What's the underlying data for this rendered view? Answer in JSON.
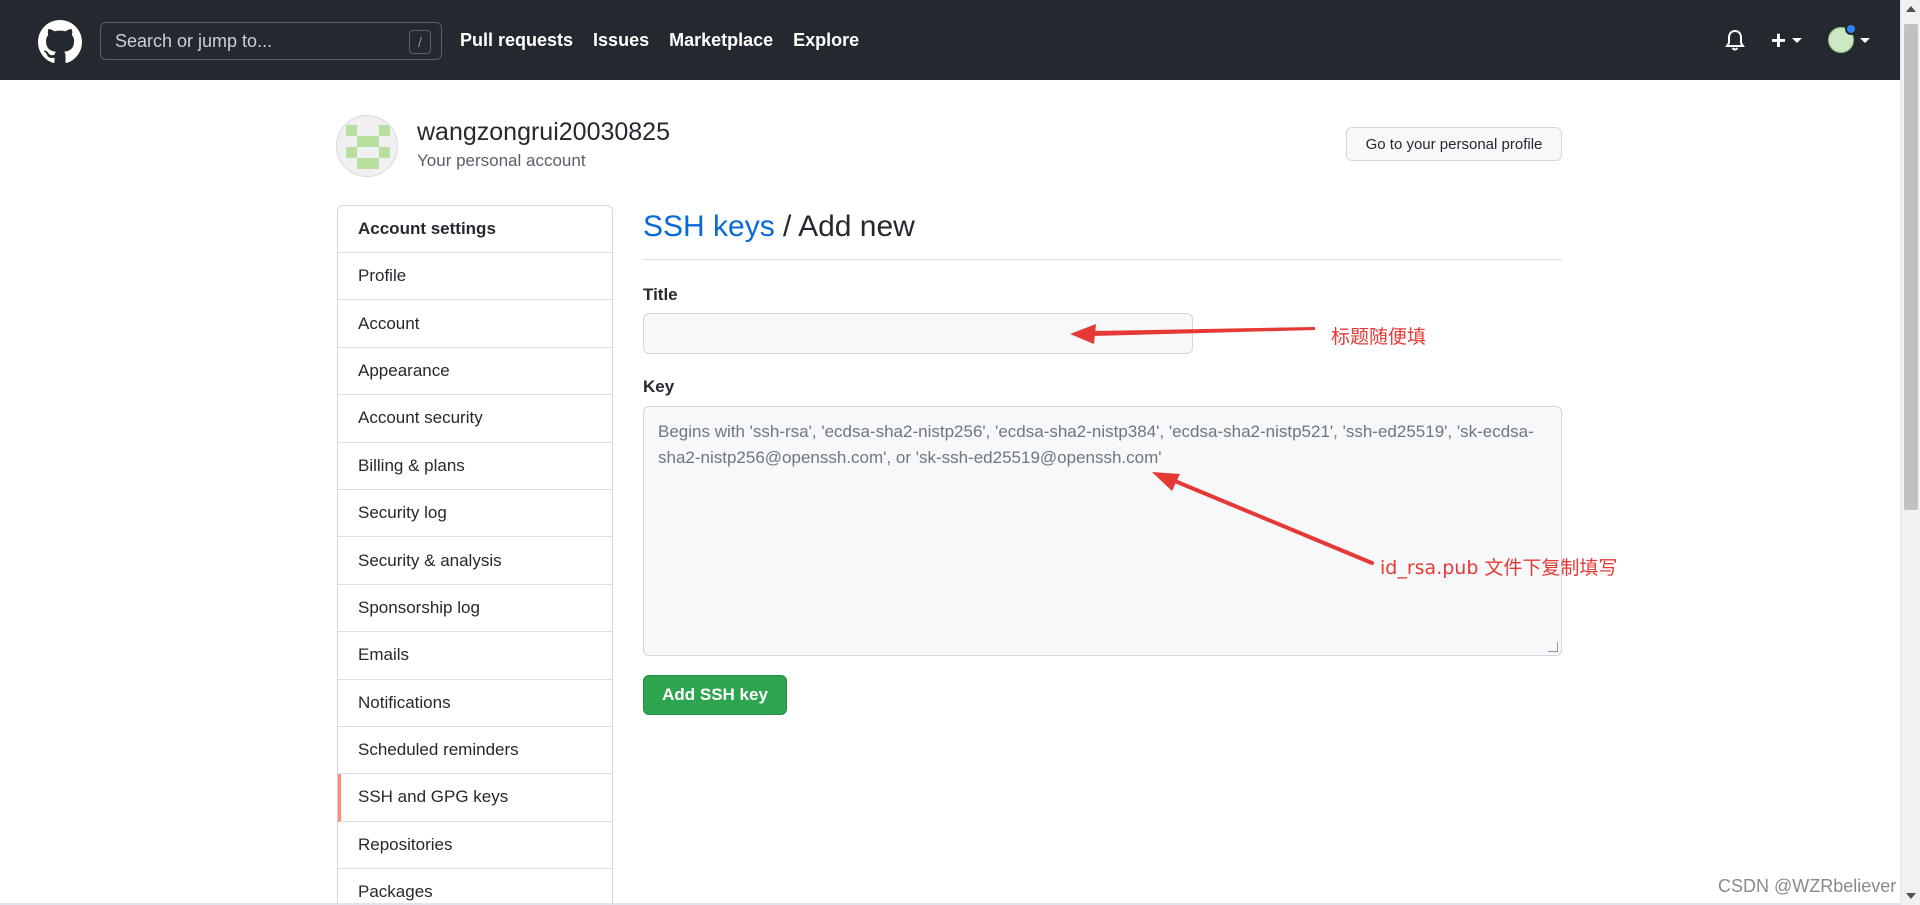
{
  "header": {
    "search_placeholder": "Search or jump to...",
    "search_shortcut": "/",
    "nav": [
      "Pull requests",
      "Issues",
      "Marketplace",
      "Explore"
    ],
    "plus_label": "+"
  },
  "user": {
    "name": "wangzongrui20030825",
    "subtitle": "Your personal account",
    "profile_button": "Go to your personal profile"
  },
  "sidebar": {
    "heading": "Account settings",
    "items": [
      {
        "label": "Profile"
      },
      {
        "label": "Account"
      },
      {
        "label": "Appearance"
      },
      {
        "label": "Account security"
      },
      {
        "label": "Billing & plans"
      },
      {
        "label": "Security log"
      },
      {
        "label": "Security & analysis"
      },
      {
        "label": "Sponsorship log"
      },
      {
        "label": "Emails"
      },
      {
        "label": "Notifications"
      },
      {
        "label": "Scheduled reminders"
      },
      {
        "label": "SSH and GPG keys",
        "active": true
      },
      {
        "label": "Repositories"
      },
      {
        "label": "Packages"
      }
    ]
  },
  "main": {
    "title_link": "SSH keys",
    "title_rest": " / Add new",
    "title_label": "Title",
    "title_value": "",
    "key_label": "Key",
    "key_placeholder": "Begins with 'ssh-rsa', 'ecdsa-sha2-nistp256', 'ecdsa-sha2-nistp384', 'ecdsa-sha2-nistp521', 'ssh-ed25519', 'sk-ecdsa-sha2-nistp256@openssh.com', or 'sk-ssh-ed25519@openssh.com'",
    "submit_label": "Add SSH key"
  },
  "annotations": {
    "title_note": "标题随便填",
    "key_note": "id_rsa.pub 文件下复制填写",
    "color": "#e53935"
  },
  "watermark": "CSDN @WZRbeliever",
  "colors": {
    "header_bg": "#24292f",
    "link": "#0969da",
    "primary_button": "#2da44e",
    "active_marker": "#fd8c73"
  }
}
